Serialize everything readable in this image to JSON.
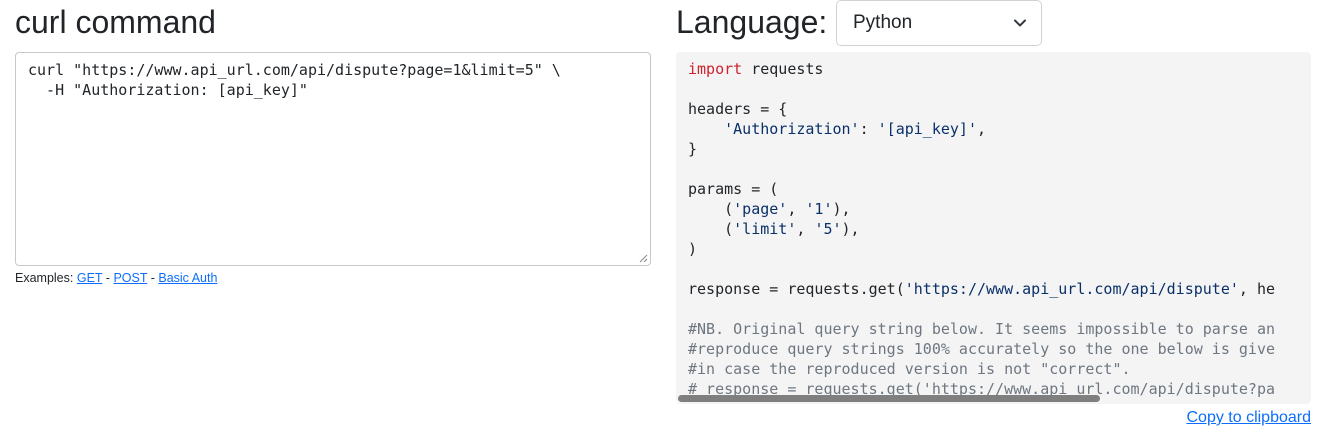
{
  "curl": {
    "title": "curl command",
    "line1": "curl \"https://www.api_url.com/api/dispute?page=1&limit=5\" \\",
    "line2": "  -H \"Authorization: [api_key]\"",
    "examples_prefix": "Examples: ",
    "examples": [
      "GET",
      "POST",
      "Basic Auth"
    ],
    "separator": " - "
  },
  "language": {
    "label": "Language:",
    "selected": "Python",
    "copy_label": "Copy to clipboard"
  },
  "code": {
    "l1_kw": "import",
    "l1_rest": " requests",
    "l3": "headers = {",
    "l4_indent": "    ",
    "l4_key": "'Authorization'",
    "l4_colon": ": ",
    "l4_val": "'[api_key]'",
    "l4_end": ",",
    "l5": "}",
    "l7": "params = (",
    "l8_open": "    (",
    "l8_a": "'page'",
    "l8_comma": ", ",
    "l8_b": "'1'",
    "l8_close": "),",
    "l9_open": "    (",
    "l9_a": "'limit'",
    "l9_comma": ", ",
    "l9_b": "'5'",
    "l9_close": "),",
    "l10": ")",
    "l12_pre": "response = requests.get(",
    "l12_url": "'https://www.api_url.com/api/dispute'",
    "l12_post": ", he",
    "c1": "#NB. Original query string below. It seems impossible to parse an",
    "c2": "#reproduce query strings 100% accurately so the one below is give",
    "c3": "#in case the reproduced version is not \"correct\".",
    "c4": "# response = requests.get('https://www.api_url.com/api/dispute?pa"
  },
  "colors": {
    "link": "#0d6efd",
    "keyword": "#cf222e",
    "string": "#0a3069",
    "comment": "#6e7781",
    "code_bg": "#f4f4f4"
  }
}
